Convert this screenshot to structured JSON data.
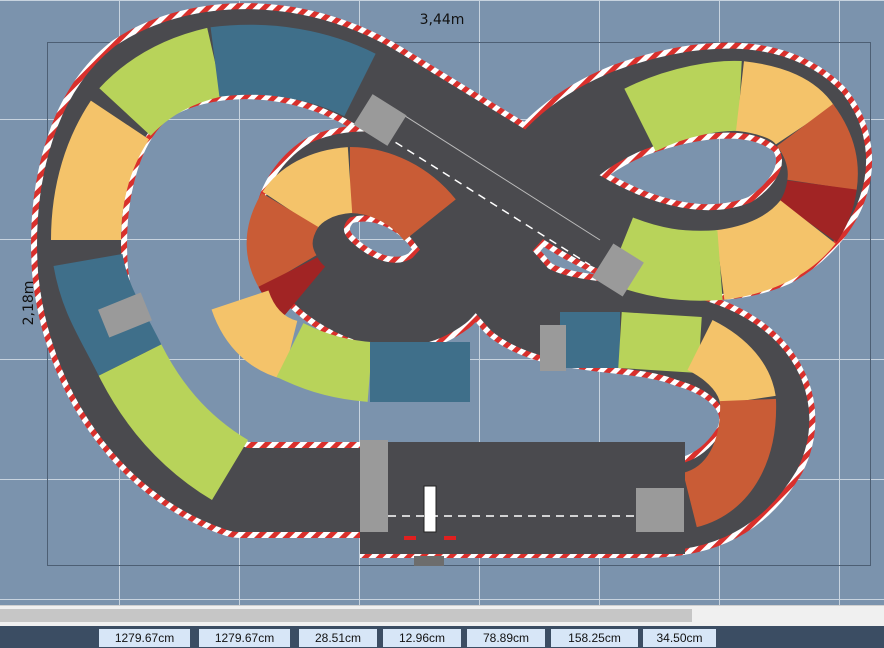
{
  "canvas": {
    "dimension_width": "3,44m",
    "dimension_height": "2,18m"
  },
  "colors": {
    "background": "#7b93ad",
    "grid": "#c7d3df",
    "asphalt": "#4a4a4e",
    "curb_red": "#d9302c",
    "curb_white": "#ffffff",
    "lane_line": "#ffffff",
    "radius_green": "#b8d35a",
    "radius_blue": "#3f6f8a",
    "radius_yellow": "#f4c36a",
    "radius_orange": "#c95c36",
    "radius_red": "#a12424"
  },
  "scrollbar": {
    "label": "horizontal-scrollbar"
  },
  "status_bar": {
    "values": [
      "1279.67cm",
      "1279.67cm",
      "28.51cm",
      "12.96cm",
      "78.89cm",
      "158.25cm",
      "34.50cm"
    ]
  }
}
